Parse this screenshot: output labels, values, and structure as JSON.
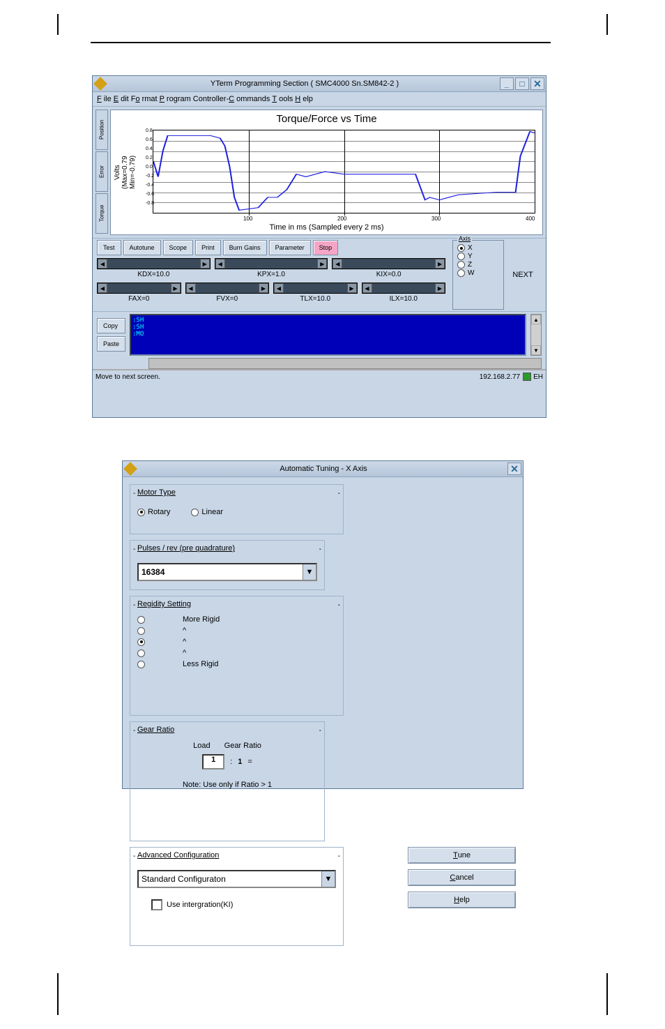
{
  "win1": {
    "title": "YTerm Programming Section ( SMC4000 Sn.SM842-2 )",
    "menus": [
      "File",
      "Edit",
      "Format",
      "Program",
      "Controller-Commands",
      "Tools",
      "Help"
    ],
    "vtabs": [
      "Position",
      "Error",
      "Torque"
    ],
    "chart_title": "Torque/Force vs Time",
    "ylabel": "Volts\n(Max=0.79\nMin=-0.79)",
    "xlabel": "Time in ms (Sampled every 2 ms)",
    "yticks": [
      "0.8",
      "0.6",
      "0.4",
      "0.2",
      "0.0",
      "-0.2",
      "-0.4",
      "-0.6",
      "-0.8"
    ],
    "xticks": [
      "100",
      "200",
      "300",
      "400"
    ],
    "buttons": [
      "Test",
      "Autotune",
      "Scope",
      "Print",
      "Burn Gains",
      "Parameter",
      "Stop"
    ],
    "sliders3": [
      {
        "label": "KDX=10.0"
      },
      {
        "label": "KPX=1.0"
      },
      {
        "label": "KIX=0.0"
      }
    ],
    "sliders4": [
      {
        "label": "FAX=0"
      },
      {
        "label": "FVX=0"
      },
      {
        "label": "TLX=10.0"
      },
      {
        "label": "ILX=10.0"
      }
    ],
    "axis_label": "Axis",
    "axes": [
      "X",
      "Y",
      "Z",
      "W"
    ],
    "next": "NEXT",
    "copy": "Copy",
    "paste": "Paste",
    "console": [
      ":SH",
      "",
      ":SH",
      ":MO"
    ],
    "status_left": "Move to next screen.",
    "status_ip": "192.168.2.77",
    "status_led": "EH"
  },
  "win2": {
    "title": "Automatic Tuning - X Axis",
    "motor_type": {
      "label": "Motor Type",
      "opts": [
        "Rotary",
        "Linear"
      ]
    },
    "pulses": {
      "label": "Pulses / rev (pre quadrature)",
      "value": "16384"
    },
    "rigidity": {
      "label": "Regidity Setting",
      "more": "More Rigid",
      "less": "Less Rigid"
    },
    "gear": {
      "label": "Gear Ratio",
      "h1": "Load",
      "h2": "Gear Ratio",
      "v1": "1",
      "v2": "1",
      "note": "Note: Use only if Ratio > 1"
    },
    "adv": {
      "label": "Advanced Configuration",
      "combo": "Standard Configuraton",
      "check": "Use intergration(KI)"
    },
    "buttons": {
      "tune": "Tune",
      "cancel": "Cancel",
      "help": "Help"
    }
  },
  "chart_data": {
    "type": "line",
    "title": "Torque/Force vs Time",
    "xlabel": "Time in ms (Sampled every 2 ms)",
    "ylabel": "Volts (Max=0.79 Min=-0.79)",
    "ylim": [
      -0.8,
      0.8
    ],
    "xlim": [
      0,
      400
    ],
    "x": [
      0,
      5,
      10,
      15,
      60,
      70,
      75,
      80,
      85,
      90,
      110,
      120,
      130,
      140,
      150,
      160,
      180,
      200,
      250,
      275,
      280,
      285,
      290,
      300,
      310,
      320,
      360,
      380,
      385,
      395,
      400
    ],
    "y": [
      0.2,
      -0.1,
      0.4,
      0.7,
      0.7,
      0.65,
      0.5,
      0.1,
      -0.5,
      -0.75,
      -0.7,
      -0.5,
      -0.5,
      -0.35,
      -0.05,
      -0.1,
      0.0,
      -0.05,
      -0.05,
      -0.05,
      -0.3,
      -0.55,
      -0.5,
      -0.55,
      -0.5,
      -0.45,
      -0.4,
      -0.4,
      0.3,
      0.78,
      0.75
    ]
  }
}
